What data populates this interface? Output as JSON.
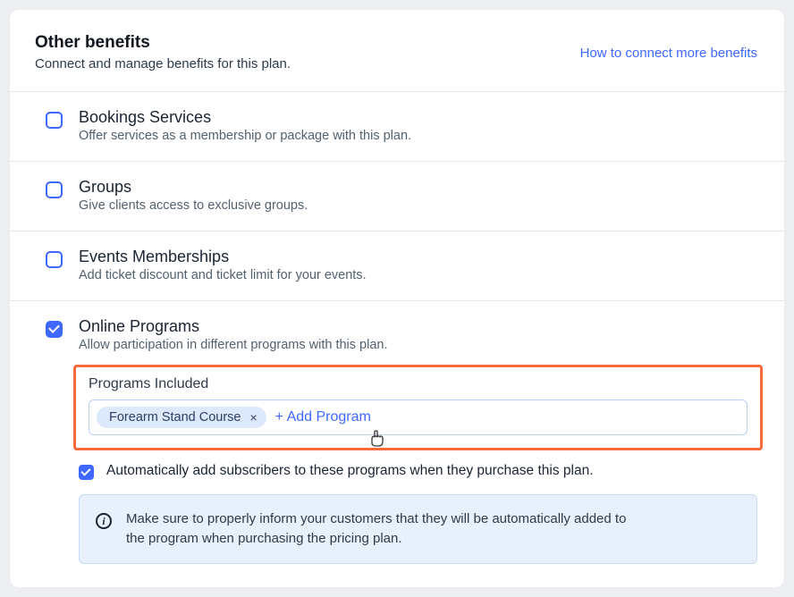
{
  "header": {
    "title": "Other benefits",
    "subtitle": "Connect and manage benefits for this plan.",
    "help_link": "How to connect more benefits"
  },
  "benefits": {
    "bookings": {
      "title": "Bookings Services",
      "desc": "Offer services as a membership or package with this plan."
    },
    "groups": {
      "title": "Groups",
      "desc": "Give clients access to exclusive groups."
    },
    "events": {
      "title": "Events Memberships",
      "desc": "Add ticket discount and ticket limit for your events."
    },
    "online_programs": {
      "title": "Online Programs",
      "desc": "Allow participation in different programs with this plan.",
      "field_label": "Programs Included",
      "chips": [
        "Forearm Stand Course"
      ],
      "add_label": "+ Add Program",
      "auto_add_label": "Automatically add subscribers to these programs when they purchase this plan.",
      "info_text": "Make sure to properly inform your customers that they will be automatically added to the program when purchasing the pricing plan."
    }
  }
}
